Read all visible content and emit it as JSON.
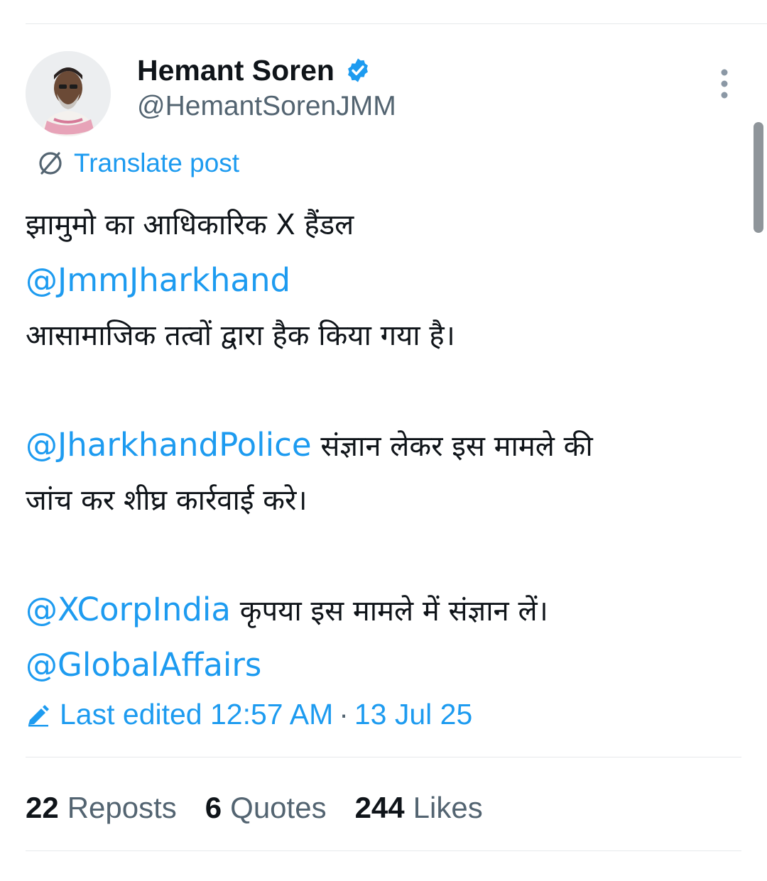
{
  "author": {
    "display_name": "Hemant Soren",
    "handle": "@HemantSorenJMM",
    "verified": true
  },
  "translate": {
    "label": "Translate post"
  },
  "post": {
    "line1": "झामुमो का आधिकारिक X हैंडल",
    "mention1": "@JmmJharkhand",
    "line3": "आसामाजिक तत्वों द्वारा हैक किया गया है।",
    "mention2": "@JharkhandPolice",
    "line4_text": " संज्ञान लेकर इस मामले की",
    "line5": "जांच कर शीघ्र कार्रवाई करे।",
    "mention3": "@XCorpIndia",
    "line6_text": " कृपया इस मामले में संज्ञान लें।",
    "mention4": "@GlobalAffairs"
  },
  "edited": {
    "label": "Last edited 12:57 AM",
    "separator": "·",
    "date": "13 Jul 25"
  },
  "stats": {
    "reposts_count": "22",
    "reposts_label": "Reposts",
    "quotes_count": "6",
    "quotes_label": "Quotes",
    "likes_count": "244",
    "likes_label": "Likes"
  },
  "colors": {
    "link": "#1d9bf0",
    "text": "#0f1419",
    "secondary": "#536471",
    "divider": "#e6e9eb"
  },
  "icons": {
    "verified": "verified-badge-icon",
    "more": "more-vertical-icon",
    "translate": "translate-globe-icon",
    "edit": "pencil-icon"
  }
}
